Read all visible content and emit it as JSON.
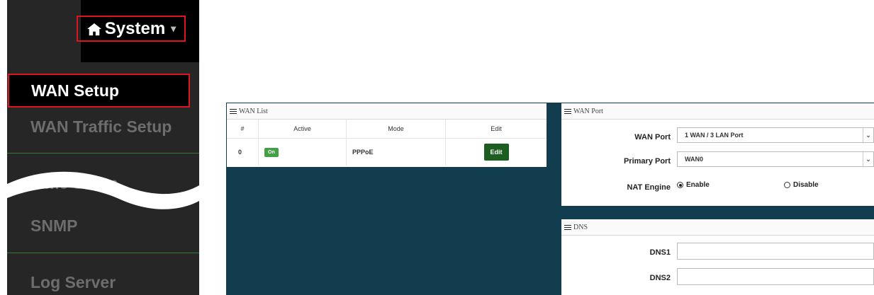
{
  "nav": {
    "system_label": "System",
    "items": [
      {
        "label": "WAN Setup",
        "active": true
      },
      {
        "label": "WAN Traffic Setup"
      },
      {
        "label": "Time Setup"
      },
      {
        "label": "SNMP"
      },
      {
        "label": "Log Server"
      }
    ]
  },
  "wan_list": {
    "title": "WAN List",
    "columns": [
      "#",
      "Active",
      "Mode",
      "Edit"
    ],
    "rows": [
      {
        "index": "0",
        "active": "On",
        "mode": "PPPoE",
        "edit": "Edit"
      }
    ]
  },
  "wan_port": {
    "title": "WAN Port",
    "wan_port_label": "WAN Port",
    "wan_port_value": "1 WAN / 3 LAN Port",
    "primary_port_label": "Primary Port",
    "primary_port_value": "WAN0",
    "nat_engine_label": "NAT Engine",
    "nat_enable": "Enable",
    "nat_disable": "Disable"
  },
  "dns": {
    "title": "DNS",
    "dns1_label": "DNS1",
    "dns1_value": "",
    "dns2_label": "DNS2",
    "dns2_value": ""
  },
  "colors": {
    "nav_bg": "#262626",
    "highlight": "#e0141e",
    "main_bg": "#113d4f",
    "edit_btn": "#1b5e20",
    "on_badge": "#43a047"
  }
}
